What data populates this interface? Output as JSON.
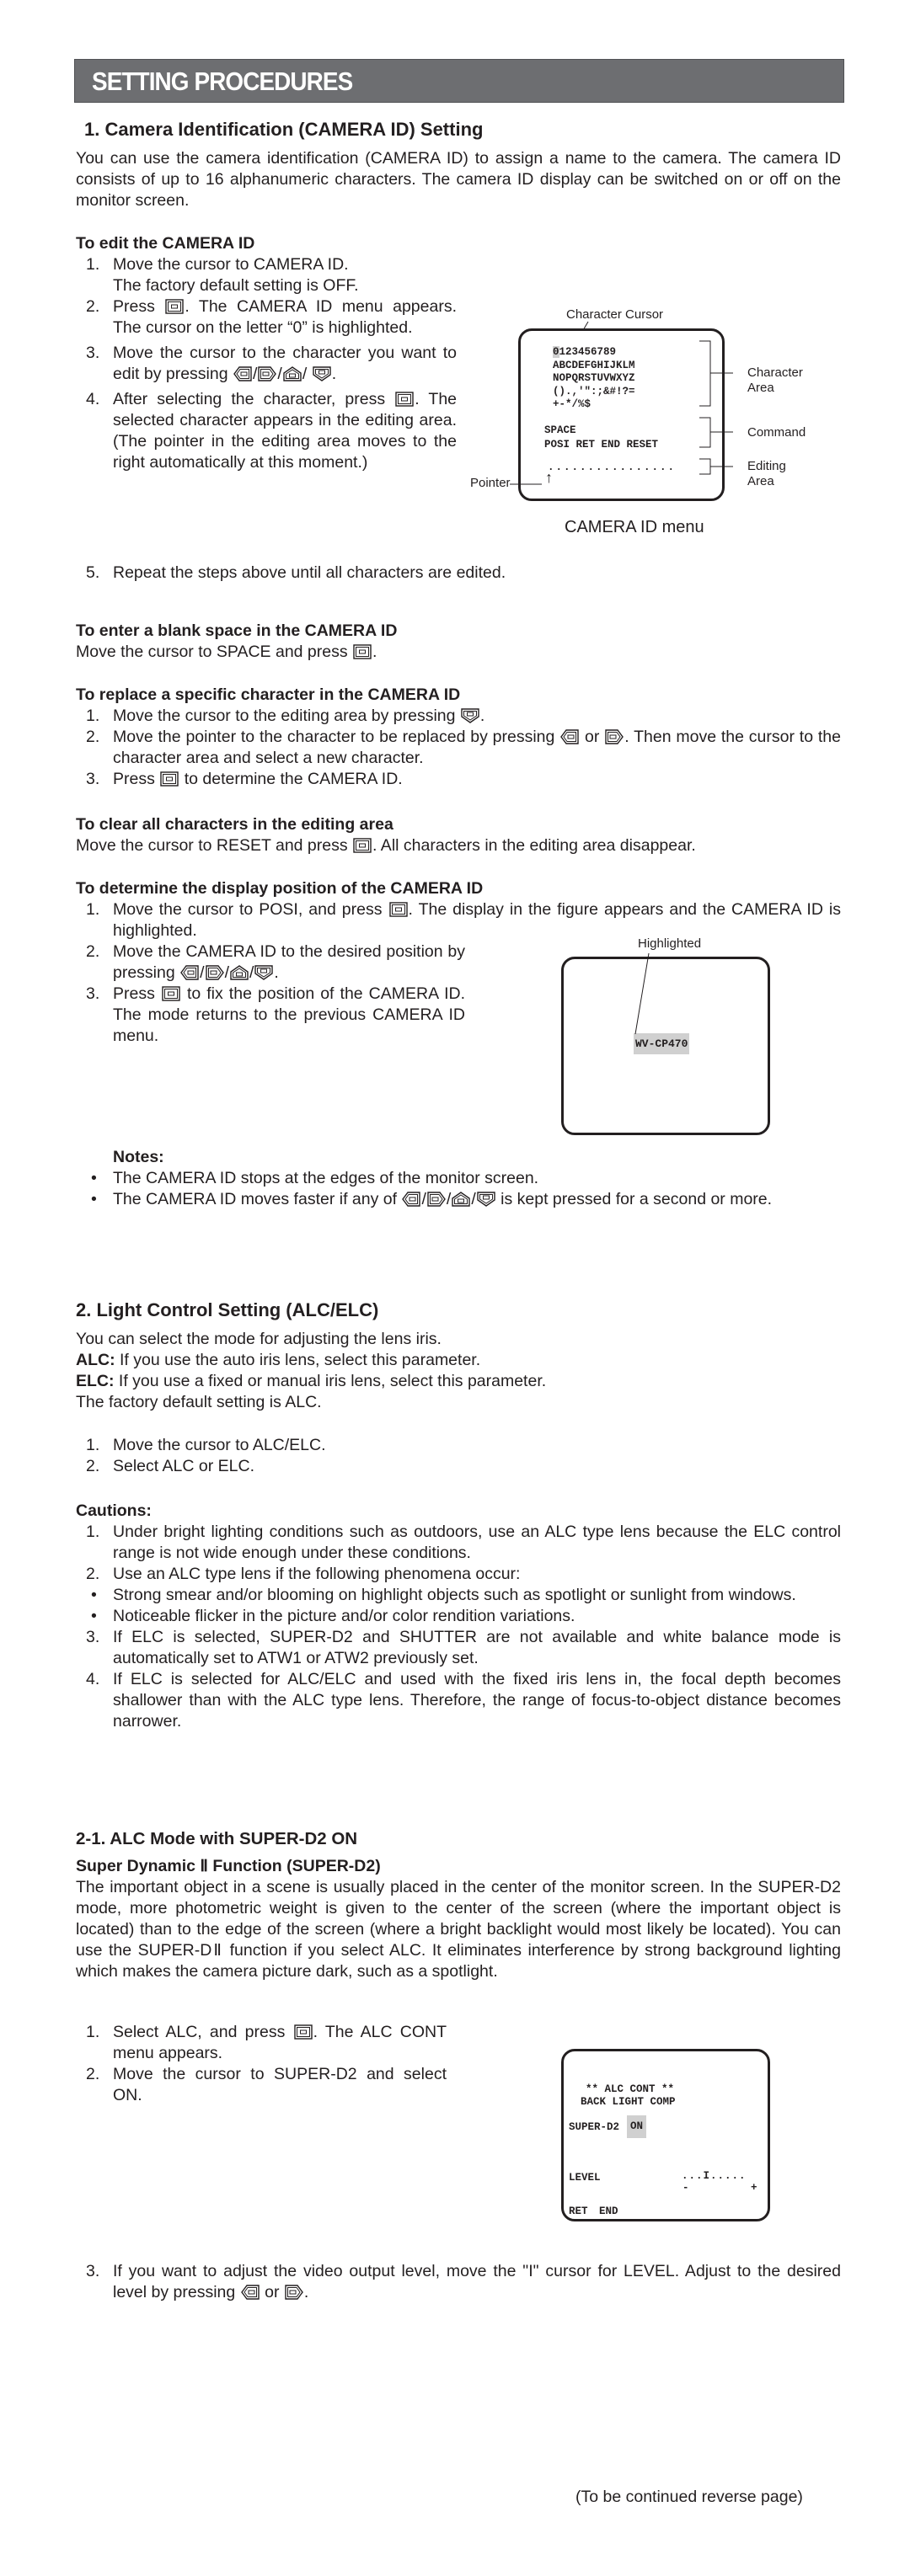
{
  "header": {
    "title": "SETTING PROCEDURES",
    "bg_color": "#6d6e71"
  },
  "section1": {
    "heading": "1.  Camera Identification (CAMERA ID) Setting",
    "intro": "You can use the camera identification (CAMERA ID) to assign a name to the camera.  The camera ID consists of up to 16 alphanumeric characters.  The camera ID display can be switched on or off on the monitor screen.",
    "edit": {
      "heading": "To edit the CAMERA ID",
      "steps": [
        {
          "num": "1.",
          "a": "Move the cursor to CAMERA ID.",
          "b": "The factory default setting is OFF."
        },
        {
          "num": "2.",
          "a": "Press",
          "b": ".  The CAMERA ID menu appears.  The cursor on the letter “0” is highlighted."
        },
        {
          "num": "3.",
          "a": "Move the cursor to the character you want to edit by pressing",
          "b": "."
        },
        {
          "num": "4.",
          "a": "After selecting the character, press",
          "b": ". The selected character appears in the editing area.  (The pointer in the editing area moves to the right automatically at this moment.)"
        },
        {
          "num": "5.",
          "a": "Repeat the steps above until all characters are edited."
        }
      ]
    },
    "camera_id_menu": {
      "caption": "CAMERA ID menu",
      "label_cursor": "Character Cursor",
      "label_char_area": "Character Area",
      "label_command": "Command",
      "label_editing": "Editing Area",
      "label_pointer": "Pointer",
      "cursor_char": "0",
      "row1_rest": "123456789",
      "row2": "ABCDEFGHIJKLM",
      "row3": "NOPQRSTUVWXYZ",
      "row4": "().,'\":;&#!?=",
      "row5": "+-*/%$",
      "cmd1": "SPACE",
      "cmd2": "POSI RET END RESET",
      "editing_dots": "................",
      "pointer_glyph": "↑"
    },
    "blank": {
      "heading": "To enter a blank space in the CAMERA ID",
      "text_a": "Move the cursor to SPACE and press",
      "text_b": "."
    },
    "replace": {
      "heading": "To replace a specific character in the CAMERA ID",
      "s1_num": "1.",
      "s1_a": "Move the cursor to the editing area by pressing",
      "s1_b": ".",
      "s2_num": "2.",
      "s2_a": "Move the pointer to the character to be replaced by pressing",
      "s2_or": "or",
      "s2_b": ". Then move the cursor to the character area and select a new character.",
      "s3_num": "3.",
      "s3_a": "Press",
      "s3_b": "to determine the CAMERA ID."
    },
    "clear": {
      "heading": "To clear all characters in the editing area",
      "text_a": "Move the cursor to RESET and press",
      "text_b": ".  All characters in the editing area disappear."
    },
    "position": {
      "heading": "To determine the display position of the CAMERA ID",
      "s1_num": "1.",
      "s1_a": "Move the cursor to POSI, and press",
      "s1_b": ".  The display in the figure appears and the CAMERA ID is highlighted.",
      "s2_num": "2.",
      "s2_a": "Move the CAMERA ID to the desired position by pressing",
      "s2_b": ".",
      "s3_num": "3.",
      "s3_a": "Press",
      "s3_b": "to fix the position of the CAMERA ID.  The mode returns to the previous CAMERA ID menu.",
      "figure_label": "Highlighted",
      "figure_id": "WV-CP470"
    },
    "notes": {
      "heading": "Notes:",
      "n1": "The CAMERA ID stops at the edges of the monitor screen.",
      "n2_a": "The CAMERA ID moves faster if any of",
      "n2_b": "is kept pressed for a second or more."
    }
  },
  "section2": {
    "heading": "2. Light Control Setting (ALC/ELC)",
    "intro": "You can select the mode for adjusting the lens iris.",
    "alc_label": "ALC:",
    "alc_text": " If you use the auto iris lens, select this parameter.",
    "elc_label": "ELC:",
    "elc_text": " If you use a fixed or manual iris lens, select this parameter.",
    "default": "The factory default setting is ALC.",
    "steps": [
      {
        "num": "1.",
        "text": "Move the cursor to ALC/ELC."
      },
      {
        "num": "2.",
        "text": "Select ALC or ELC."
      }
    ],
    "cautions_heading": "Cautions:",
    "cautions": {
      "c1_num": "1.",
      "c1": "Under bright lighting conditions such as outdoors, use an ALC type lens because the ELC control range is not wide enough under these conditions.",
      "c2_num": "2.",
      "c2": "Use an ALC type lens if the following phenomena occur:",
      "c2_b1": "Strong smear and/or blooming on highlight objects such as spotlight or sunlight from windows.",
      "c2_b2": "Noticeable flicker in the picture and/or color rendition variations.",
      "c3_num": "3.",
      "c3": "If ELC is selected, SUPER-D2 and SHUTTER are not available and white balance mode is automatically set to ATW1 or ATW2 previously set.",
      "c4_num": "4.",
      "c4": "If ELC is selected for ALC/ELC and used with the fixed iris lens in, the focal depth becomes shallower than with the ALC type lens. Therefore, the range of focus-to-object distance becomes narrower."
    }
  },
  "section21": {
    "heading": "2-1. ALC Mode with SUPER-D2 ON",
    "subheading": "Super Dynamic Ⅱ Function (SUPER-D2)",
    "body": "The important object in a scene is usually placed in the center of the monitor screen. In the SUPER-D2 mode, more photometric weight is given to the center of the screen (where the important object is located) than to the edge of the screen (where a bright backlight would most likely be located). You can use the SUPER-DⅡ function if you select ALC. It eliminates interference by strong background lighting which makes the camera picture dark, such as a spotlight.",
    "s1_num": "1.",
    "s1_a": "Select ALC, and press",
    "s1_b": ". The  ALC CONT menu appears.",
    "s2_num": "2.",
    "s2": "Move the cursor to SUPER-D2 and select ON.",
    "s3_num": "3.",
    "s3_a": "If you want to adjust the video output level, move the \"I\" cursor for LEVEL. Adjust to the desired level by pressing",
    "s3_or": "or",
    "s3_b": ".",
    "alc_menu": {
      "title1": "** ALC CONT **",
      "title2": "BACK LIGHT COMP",
      "superd2_label": "SUPER-D2",
      "superd2_value": "ON",
      "level_label": "LEVEL",
      "level_scale": "...I.....",
      "level_minus": "-",
      "level_plus": "+",
      "ret": "RET",
      "end": "END"
    }
  },
  "footer": {
    "text": "(To be continued reverse page)"
  }
}
